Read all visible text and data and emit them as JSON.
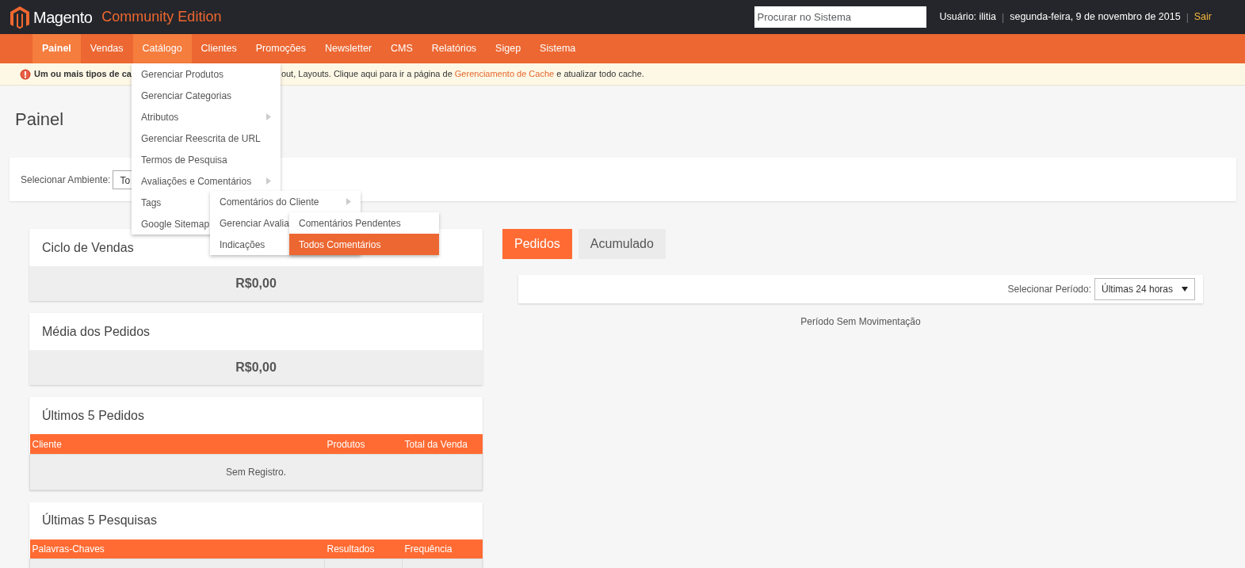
{
  "header": {
    "brand": "Magento",
    "edition": "Community Edition",
    "search": {
      "placeholder": "Procurar no Sistema"
    },
    "user": "Usuário: ilitia",
    "separators": [
      "|",
      "|"
    ],
    "date": "segunda-feira, 9 de novembro de 2015",
    "logout": "Sair"
  },
  "nav": [
    {
      "label": "Painel",
      "selected": true,
      "expanded": false
    },
    {
      "label": "Vendas",
      "selected": false,
      "expanded": false
    },
    {
      "label": "Catálogo",
      "selected": false,
      "expanded": true
    },
    {
      "label": "Clientes",
      "selected": false,
      "expanded": false
    },
    {
      "label": "Promoções",
      "selected": false,
      "expanded": false
    },
    {
      "label": "Newsletter",
      "selected": false,
      "expanded": false
    },
    {
      "label": "CMS",
      "selected": false,
      "expanded": false
    },
    {
      "label": "Relatórios",
      "selected": false,
      "expanded": false
    },
    {
      "label": "Sigep",
      "selected": false,
      "expanded": false
    },
    {
      "label": "Sistema",
      "selected": false,
      "expanded": false
    }
  ],
  "notice": {
    "bold_part": "Um ou mais tipos de ca",
    "text": "out, Layouts. Clique aqui para ir a página de ",
    "link": "Gerenciamento de Cache",
    "tail": " e atualizar todo cache."
  },
  "menus": [
    [
      {
        "label": "Gerenciar Produtos",
        "selected": false
      },
      {
        "label": "Gerenciar Categorias",
        "selected": false
      },
      {
        "label": "Atributos",
        "has_submenu": true,
        "selected": false
      },
      {
        "label": "Gerenciar Reescrita de URL",
        "selected": false
      },
      {
        "label": "Termos de Pesquisa",
        "selected": false
      },
      {
        "label": "Avaliações e Comentários",
        "has_submenu": true,
        "selected": false
      },
      {
        "label": "Tags",
        "selected": false
      },
      {
        "label": "Google Sitemap",
        "selected": false
      }
    ],
    [
      {
        "label": "Comentários do Cliente",
        "has_submenu": true,
        "selected": false
      },
      {
        "label": "Gerenciar Avalia",
        "selected": false
      },
      {
        "label": "Indicações",
        "selected": false
      }
    ],
    [
      {
        "label": "Comentários Pendentes",
        "selected": false
      },
      {
        "label": "Todos Comentários",
        "selected": true
      }
    ]
  ],
  "page_title": "Painel",
  "store_switcher": {
    "label": "Selecionar Ambiente:",
    "value": "To"
  },
  "left_panels": [
    {
      "kind": "value",
      "title": "Ciclo de Vendas",
      "value": "R$0,00"
    },
    {
      "kind": "value",
      "title": "Média dos Pedidos",
      "value": "R$0,00"
    },
    {
      "kind": "table",
      "title": "Últimos 5 Pedidos",
      "columns": [
        "Cliente",
        "Produtos",
        "Total da Venda"
      ],
      "empty": "Sem Registro."
    },
    {
      "kind": "table",
      "title": "Últimas 5 Pesquisas",
      "columns": [
        "Palavras-Chaves",
        "Resultados",
        "Frequência"
      ]
    }
  ],
  "chart_tabs": [
    {
      "label": "Pedidos",
      "selected": true
    },
    {
      "label": "Acumulado",
      "selected": false
    }
  ],
  "period": {
    "label": "Selecionar Período:",
    "value": "Últimas 24 horas"
  },
  "chart_empty": "Período Sem Movimentação"
}
